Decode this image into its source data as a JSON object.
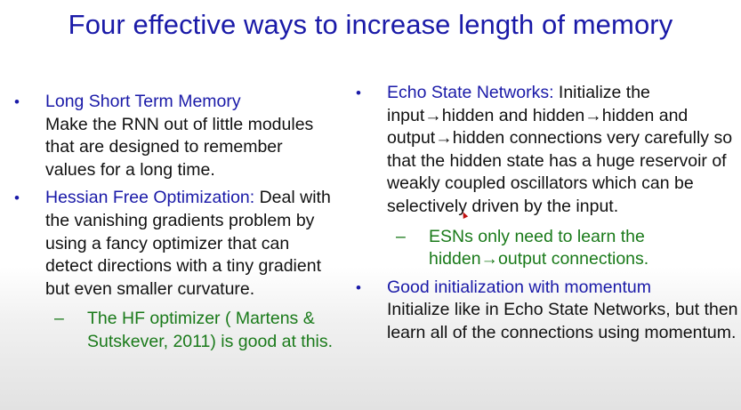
{
  "title": "Four effective ways to increase length of memory",
  "left": {
    "items": [
      {
        "bullet": "•",
        "head": "Long Short Term Memory",
        "body": "Make the RNN out of little modules that are designed to remember values for a long time."
      },
      {
        "bullet": "•",
        "head": "Hessian Free Optimization:",
        "body": " Deal with the vanishing gradients problem by using a fancy optimizer that can detect directions with a tiny gradient but even smaller curvature.",
        "sub": "The HF optimizer ( Martens & Sutskever, 2011) is good at this."
      }
    ]
  },
  "right": {
    "items": [
      {
        "bullet": "•",
        "head": "Echo State Networks:",
        "body": "  Initialize the input→hidden and hidden→hidden and output→hidden connections very carefully so that the hidden state has a huge reservoir of weakly coupled oscillators which can be selectively driven by the input.",
        "sub": "ESNs only need to learn the hidden→output connections."
      },
      {
        "bullet": "•",
        "head": "Good initialization with momentum",
        "body": "Initialize like in Echo State Networks, but then learn all of the connections using momentum."
      }
    ]
  },
  "dash": "–"
}
